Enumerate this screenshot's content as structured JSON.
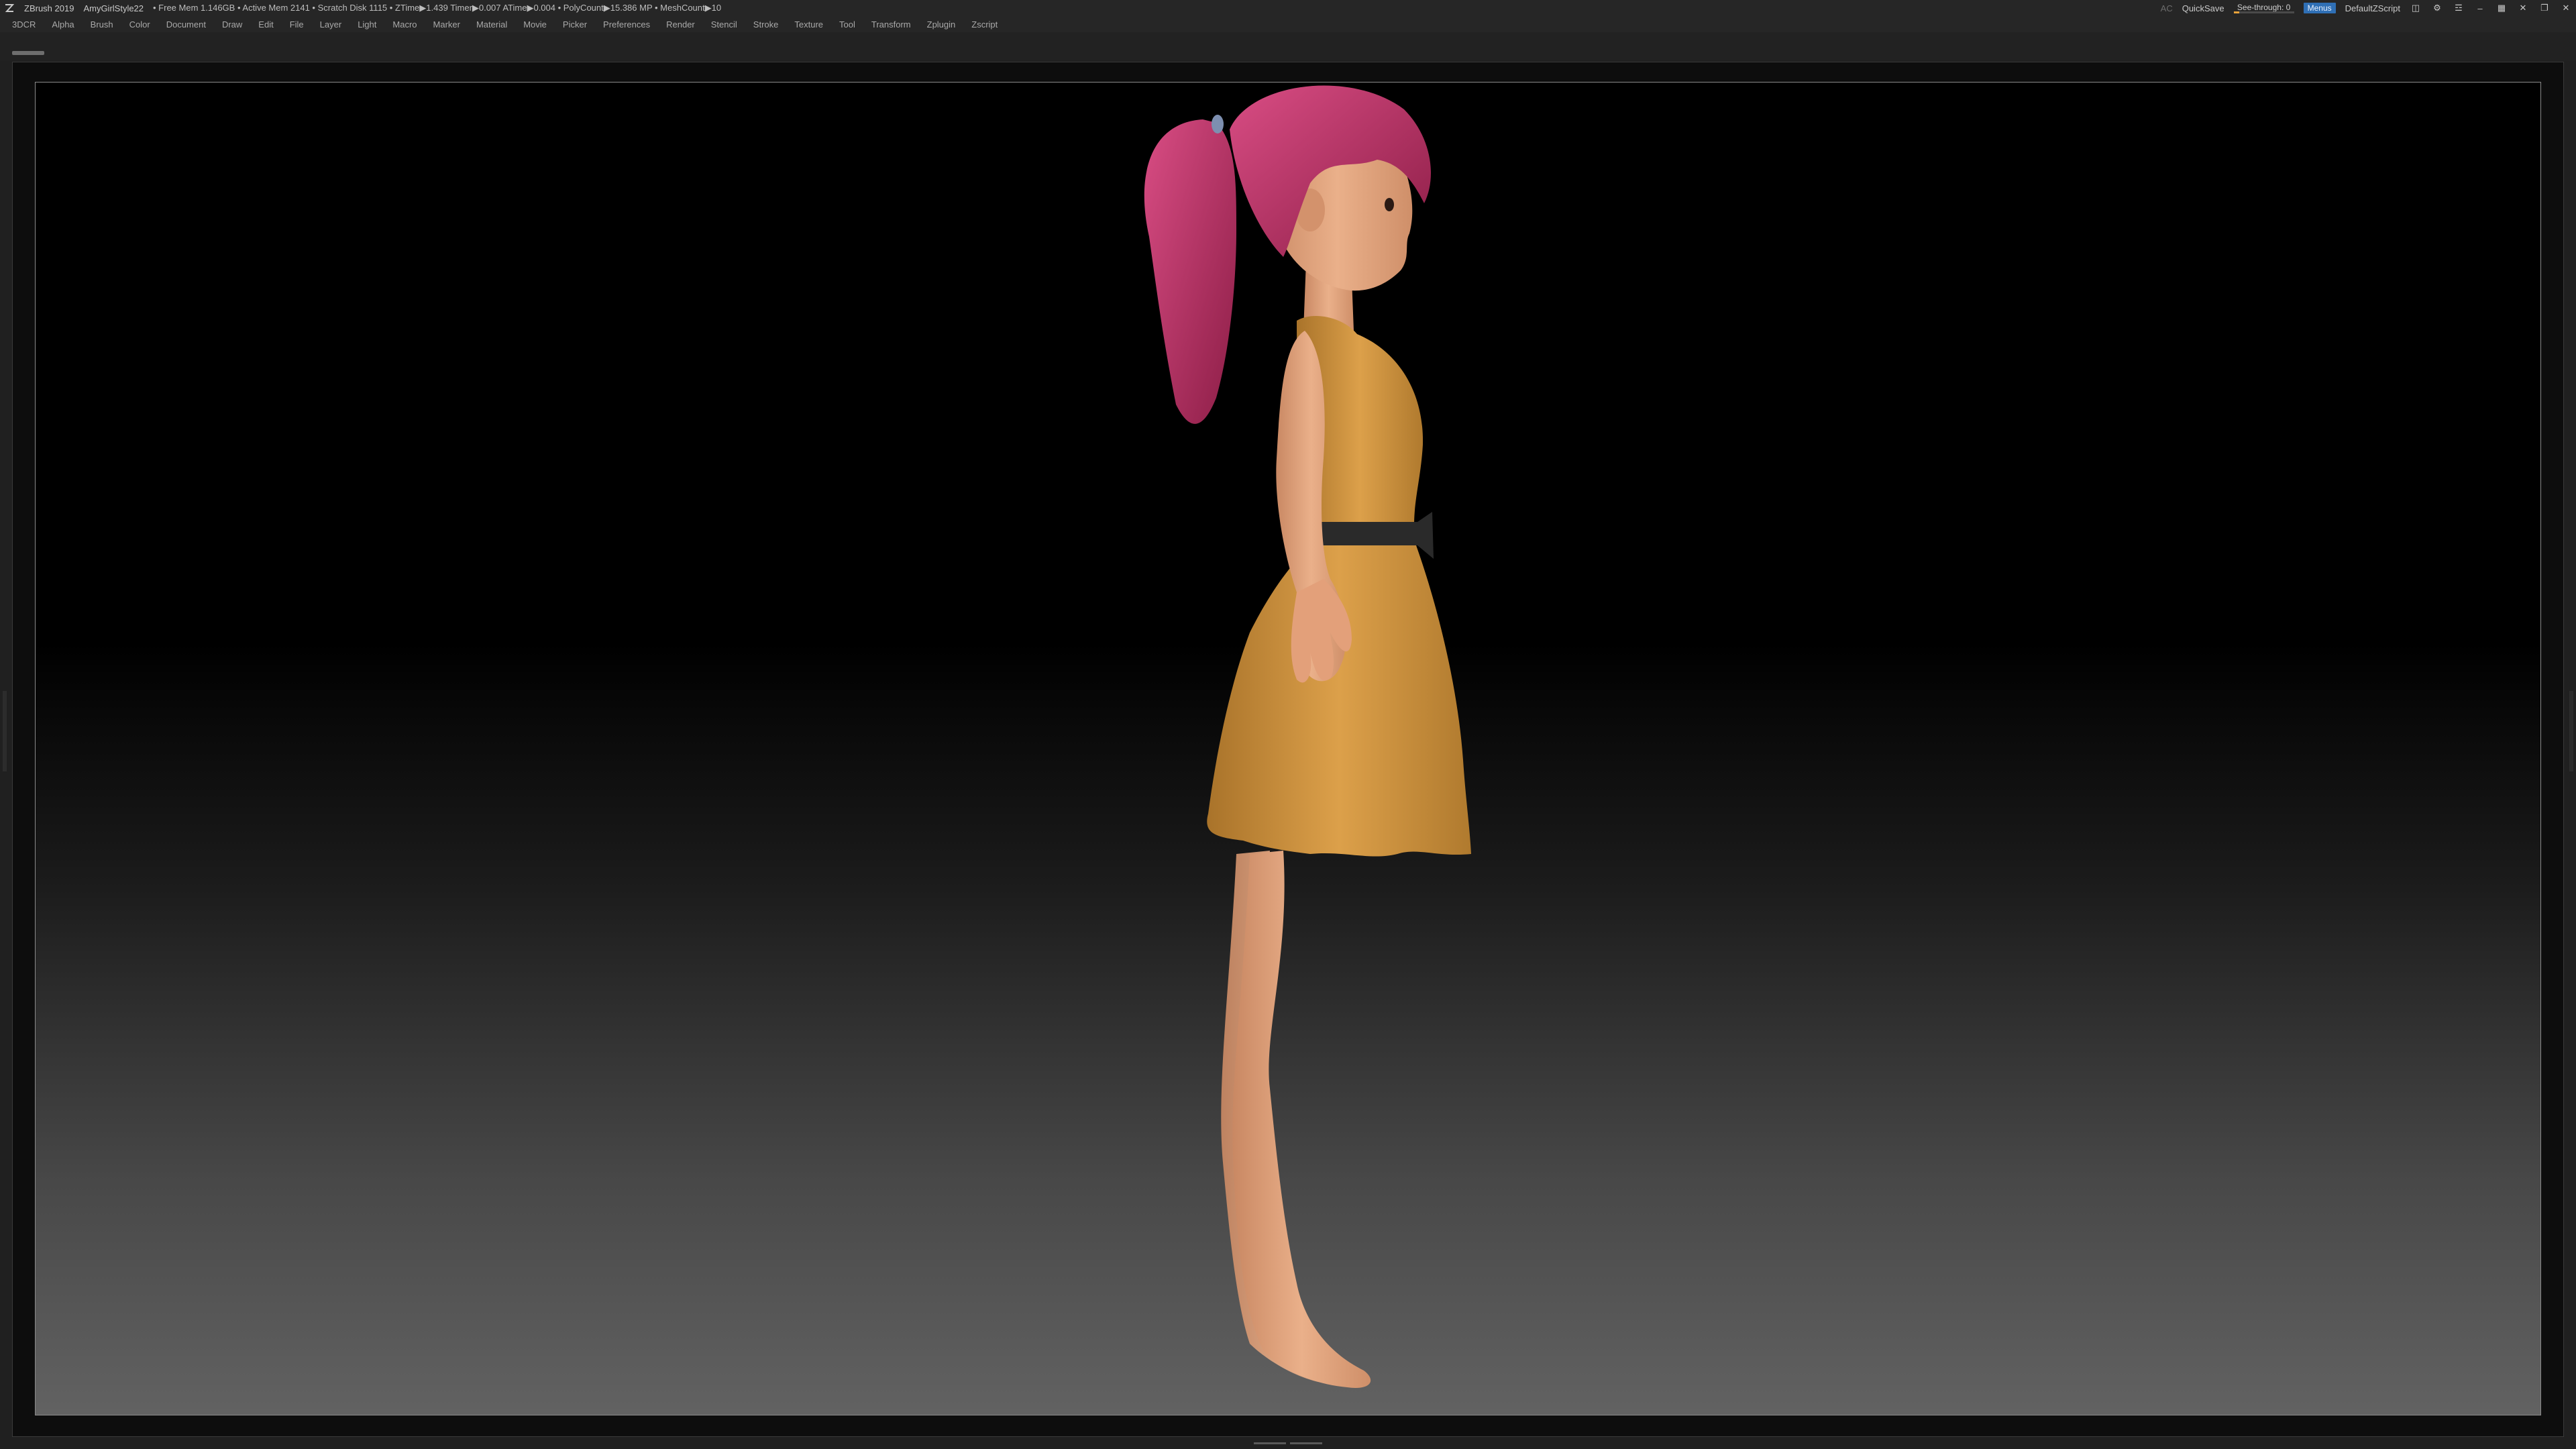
{
  "titlebar": {
    "app_name": "ZBrush 2019",
    "document_name": "AmyGirlStyle22",
    "stats": "• Free Mem 1.146GB • Active Mem 2141 • Scratch Disk 1115 • ZTime▶1.439 Timer▶0.007 ATime▶0.004 • PolyCount▶15.386 MP • MeshCount▶10",
    "ac_label": "AC",
    "quicksave_label": "QuickSave",
    "see_through_label": "See-through",
    "see_through_value": "0",
    "see_through_fraction": 0,
    "menus_label": "Menus",
    "script_label": "DefaultZScript"
  },
  "menu": {
    "items": [
      "3DCR",
      "Alpha",
      "Brush",
      "Color",
      "Document",
      "Draw",
      "Edit",
      "File",
      "Layer",
      "Light",
      "Macro",
      "Marker",
      "Material",
      "Movie",
      "Picker",
      "Preferences",
      "Render",
      "Stencil",
      "Stroke",
      "Texture",
      "Tool",
      "Transform",
      "Zplugin",
      "Zscript"
    ]
  },
  "colors": {
    "menus_accent": "#2f6fb5",
    "slider_accent": "#e8a23a",
    "hair": "#b5285e",
    "skin": "#e6a57f",
    "dress": "#d69a3a",
    "belt": "#2a2a2a"
  },
  "icons": [
    "zbrush-logo-icon",
    "layout-icon",
    "script-icon",
    "help-icon",
    "minimize-icon",
    "restore-icon",
    "close-icon"
  ]
}
